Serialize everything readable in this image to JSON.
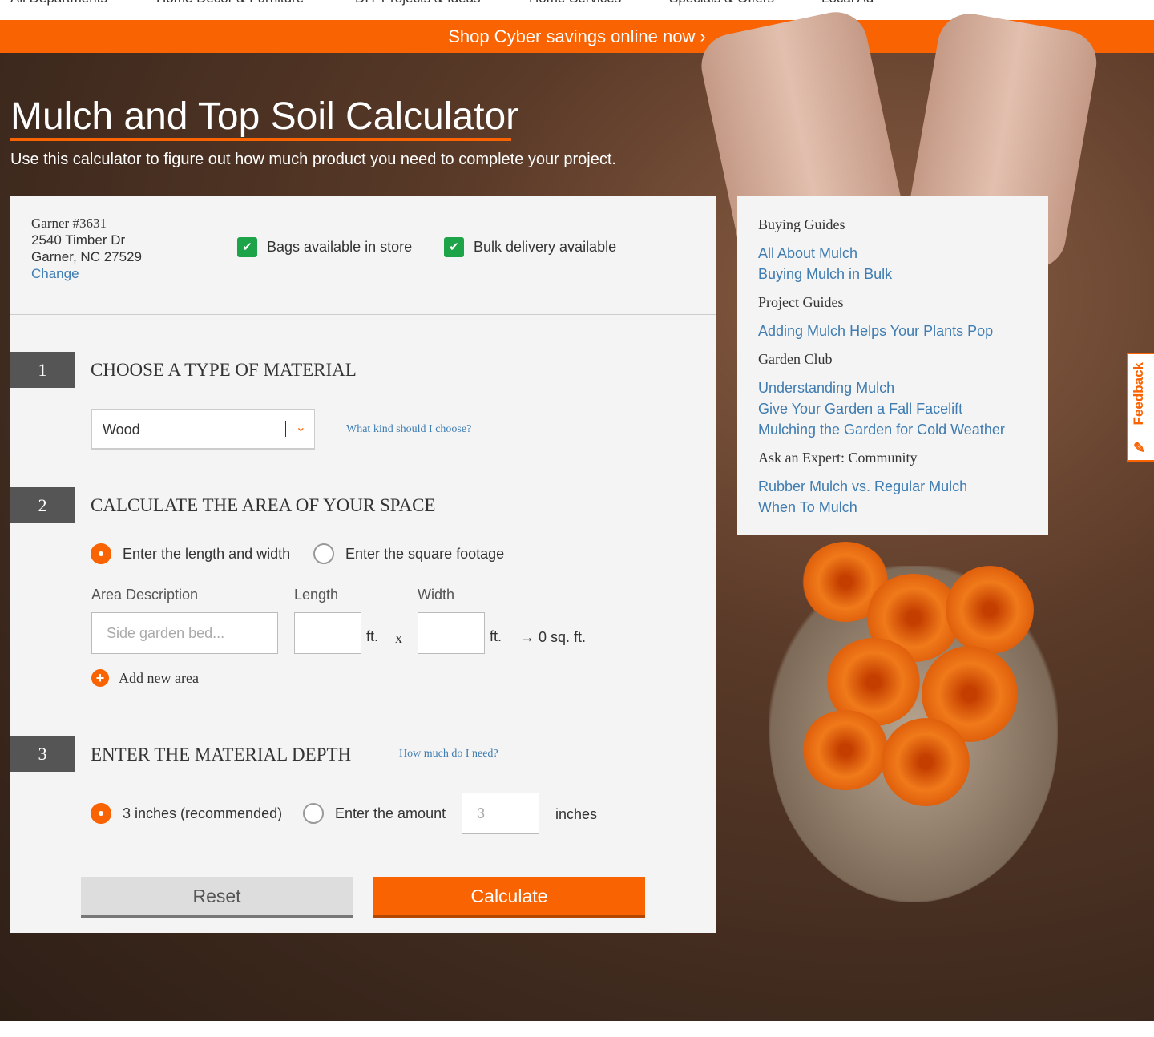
{
  "nav": [
    "All Departments",
    "Home Decor & Furniture",
    "DIY Projects & Ideas",
    "Home Services",
    "Specials & Offers",
    "Local Ad"
  ],
  "banner": "Shop Cyber savings online now ›",
  "title": "Mulch and Top Soil Calculator",
  "subtitle": "Use this calculator to figure out how much product you need to complete your project.",
  "store": {
    "name": "Garner #3631",
    "street": "2540 Timber Dr",
    "city": "Garner, NC 27529",
    "change": "Change"
  },
  "availability": {
    "bags": "Bags available in store",
    "bulk": "Bulk delivery available"
  },
  "step1": {
    "num": "1",
    "title": "CHOOSE A TYPE OF MATERIAL",
    "selected": "Wood",
    "help": "What kind should I choose?"
  },
  "step2": {
    "num": "2",
    "title": "CALCULATE THE AREA OF YOUR SPACE",
    "opt1": "Enter the length and width",
    "opt2": "Enter the square footage",
    "area_label": "Area Description",
    "length_label": "Length",
    "width_label": "Width",
    "area_placeholder": "Side garden bed...",
    "ft": "ft.",
    "x": "x",
    "result": "→ 0 sq. ft.",
    "add": "Add new area"
  },
  "step3": {
    "num": "3",
    "title": "ENTER THE MATERIAL DEPTH",
    "help": "How much do I need?",
    "opt1": "3 inches (recommended)",
    "opt2": "Enter the amount",
    "amount": "3",
    "unit": "inches"
  },
  "buttons": {
    "reset": "Reset",
    "calculate": "Calculate"
  },
  "sidebar": [
    {
      "heading": "Buying Guides",
      "links": [
        "All About Mulch",
        "Buying Mulch in Bulk"
      ]
    },
    {
      "heading": "Project Guides",
      "links": [
        "Adding Mulch Helps Your Plants Pop"
      ]
    },
    {
      "heading": "Garden Club",
      "links": [
        "Understanding Mulch",
        "Give Your Garden a Fall Facelift",
        "Mulching the Garden for Cold Weather"
      ]
    },
    {
      "heading": "Ask an Expert: Community",
      "links": [
        "Rubber Mulch vs. Regular Mulch",
        "When To Mulch"
      ]
    }
  ],
  "feedback": "Feedback",
  "icons": {
    "availability": "check-icon",
    "material_select": "chevron-down-icon",
    "add_area": "plus-icon",
    "feedback": "feedback-icon"
  },
  "colors": {
    "accent": "#f96302",
    "link": "#3e7cb1",
    "check": "#1da348"
  }
}
